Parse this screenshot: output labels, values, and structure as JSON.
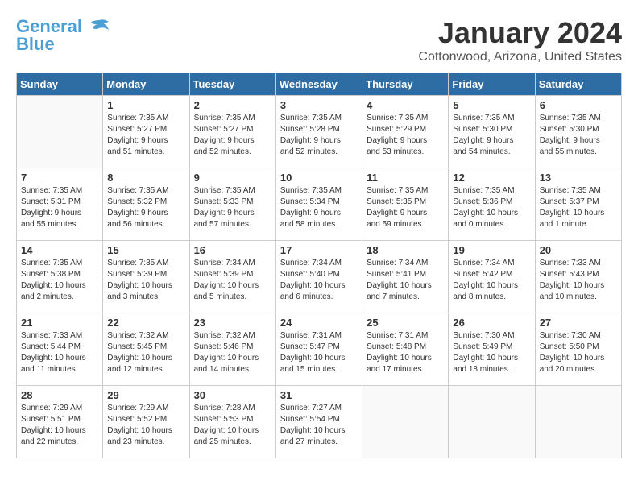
{
  "header": {
    "logo_line1": "General",
    "logo_line2": "Blue",
    "month_title": "January 2024",
    "location": "Cottonwood, Arizona, United States"
  },
  "weekdays": [
    "Sunday",
    "Monday",
    "Tuesday",
    "Wednesday",
    "Thursday",
    "Friday",
    "Saturday"
  ],
  "weeks": [
    [
      {
        "day": "",
        "info": ""
      },
      {
        "day": "1",
        "info": "Sunrise: 7:35 AM\nSunset: 5:27 PM\nDaylight: 9 hours\nand 51 minutes."
      },
      {
        "day": "2",
        "info": "Sunrise: 7:35 AM\nSunset: 5:27 PM\nDaylight: 9 hours\nand 52 minutes."
      },
      {
        "day": "3",
        "info": "Sunrise: 7:35 AM\nSunset: 5:28 PM\nDaylight: 9 hours\nand 52 minutes."
      },
      {
        "day": "4",
        "info": "Sunrise: 7:35 AM\nSunset: 5:29 PM\nDaylight: 9 hours\nand 53 minutes."
      },
      {
        "day": "5",
        "info": "Sunrise: 7:35 AM\nSunset: 5:30 PM\nDaylight: 9 hours\nand 54 minutes."
      },
      {
        "day": "6",
        "info": "Sunrise: 7:35 AM\nSunset: 5:30 PM\nDaylight: 9 hours\nand 55 minutes."
      }
    ],
    [
      {
        "day": "7",
        "info": "Sunrise: 7:35 AM\nSunset: 5:31 PM\nDaylight: 9 hours\nand 55 minutes."
      },
      {
        "day": "8",
        "info": "Sunrise: 7:35 AM\nSunset: 5:32 PM\nDaylight: 9 hours\nand 56 minutes."
      },
      {
        "day": "9",
        "info": "Sunrise: 7:35 AM\nSunset: 5:33 PM\nDaylight: 9 hours\nand 57 minutes."
      },
      {
        "day": "10",
        "info": "Sunrise: 7:35 AM\nSunset: 5:34 PM\nDaylight: 9 hours\nand 58 minutes."
      },
      {
        "day": "11",
        "info": "Sunrise: 7:35 AM\nSunset: 5:35 PM\nDaylight: 9 hours\nand 59 minutes."
      },
      {
        "day": "12",
        "info": "Sunrise: 7:35 AM\nSunset: 5:36 PM\nDaylight: 10 hours\nand 0 minutes."
      },
      {
        "day": "13",
        "info": "Sunrise: 7:35 AM\nSunset: 5:37 PM\nDaylight: 10 hours\nand 1 minute."
      }
    ],
    [
      {
        "day": "14",
        "info": "Sunrise: 7:35 AM\nSunset: 5:38 PM\nDaylight: 10 hours\nand 2 minutes."
      },
      {
        "day": "15",
        "info": "Sunrise: 7:35 AM\nSunset: 5:39 PM\nDaylight: 10 hours\nand 3 minutes."
      },
      {
        "day": "16",
        "info": "Sunrise: 7:34 AM\nSunset: 5:39 PM\nDaylight: 10 hours\nand 5 minutes."
      },
      {
        "day": "17",
        "info": "Sunrise: 7:34 AM\nSunset: 5:40 PM\nDaylight: 10 hours\nand 6 minutes."
      },
      {
        "day": "18",
        "info": "Sunrise: 7:34 AM\nSunset: 5:41 PM\nDaylight: 10 hours\nand 7 minutes."
      },
      {
        "day": "19",
        "info": "Sunrise: 7:34 AM\nSunset: 5:42 PM\nDaylight: 10 hours\nand 8 minutes."
      },
      {
        "day": "20",
        "info": "Sunrise: 7:33 AM\nSunset: 5:43 PM\nDaylight: 10 hours\nand 10 minutes."
      }
    ],
    [
      {
        "day": "21",
        "info": "Sunrise: 7:33 AM\nSunset: 5:44 PM\nDaylight: 10 hours\nand 11 minutes."
      },
      {
        "day": "22",
        "info": "Sunrise: 7:32 AM\nSunset: 5:45 PM\nDaylight: 10 hours\nand 12 minutes."
      },
      {
        "day": "23",
        "info": "Sunrise: 7:32 AM\nSunset: 5:46 PM\nDaylight: 10 hours\nand 14 minutes."
      },
      {
        "day": "24",
        "info": "Sunrise: 7:31 AM\nSunset: 5:47 PM\nDaylight: 10 hours\nand 15 minutes."
      },
      {
        "day": "25",
        "info": "Sunrise: 7:31 AM\nSunset: 5:48 PM\nDaylight: 10 hours\nand 17 minutes."
      },
      {
        "day": "26",
        "info": "Sunrise: 7:30 AM\nSunset: 5:49 PM\nDaylight: 10 hours\nand 18 minutes."
      },
      {
        "day": "27",
        "info": "Sunrise: 7:30 AM\nSunset: 5:50 PM\nDaylight: 10 hours\nand 20 minutes."
      }
    ],
    [
      {
        "day": "28",
        "info": "Sunrise: 7:29 AM\nSunset: 5:51 PM\nDaylight: 10 hours\nand 22 minutes."
      },
      {
        "day": "29",
        "info": "Sunrise: 7:29 AM\nSunset: 5:52 PM\nDaylight: 10 hours\nand 23 minutes."
      },
      {
        "day": "30",
        "info": "Sunrise: 7:28 AM\nSunset: 5:53 PM\nDaylight: 10 hours\nand 25 minutes."
      },
      {
        "day": "31",
        "info": "Sunrise: 7:27 AM\nSunset: 5:54 PM\nDaylight: 10 hours\nand 27 minutes."
      },
      {
        "day": "",
        "info": ""
      },
      {
        "day": "",
        "info": ""
      },
      {
        "day": "",
        "info": ""
      }
    ]
  ]
}
